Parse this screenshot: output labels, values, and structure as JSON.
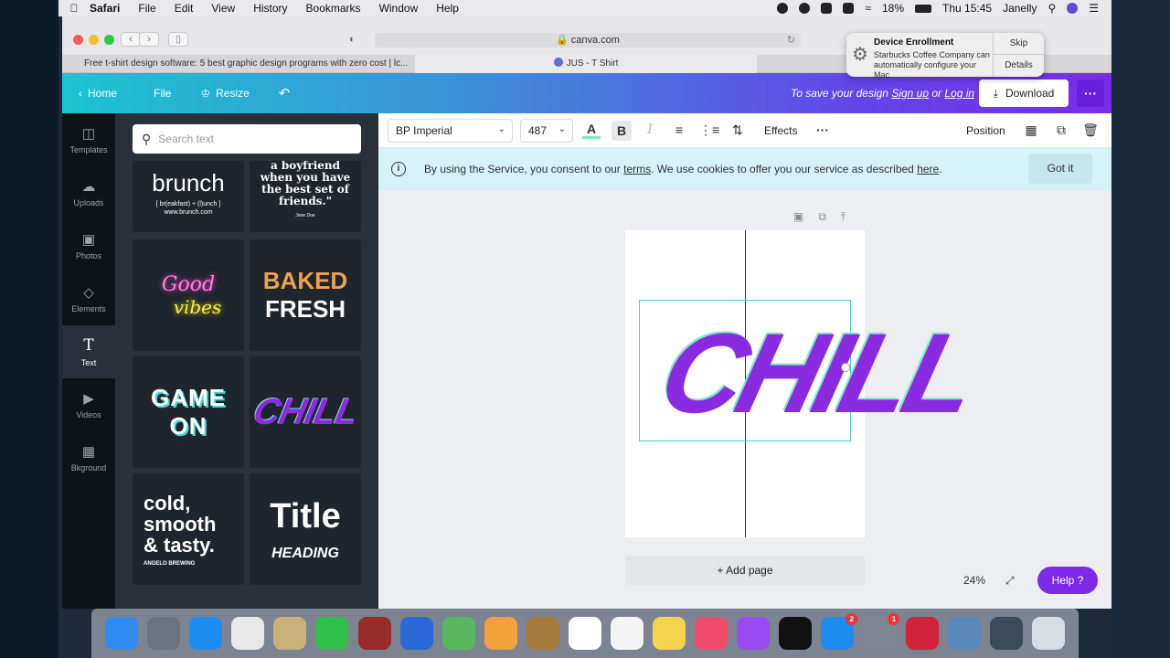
{
  "menubar": {
    "app": "Safari",
    "items": [
      "File",
      "Edit",
      "View",
      "History",
      "Bookmarks",
      "Window",
      "Help"
    ],
    "battery": "18%",
    "clock": "Thu 15:45",
    "user": "Janelly"
  },
  "browser": {
    "url": "canva.com",
    "tabs": [
      "Free t-shirt design software: 5 best graphic design programs with zero cost | lc...",
      "JUS - T Shirt"
    ]
  },
  "notification": {
    "title": "Device Enrollment",
    "body": "Starbucks Coffee Company can automatically configure your Mac.",
    "skip": "Skip",
    "details": "Details"
  },
  "header": {
    "home": "Home",
    "file": "File",
    "resize": "Resize",
    "save_prefix": "To save your design",
    "sign_up": "Sign up",
    "or": "or",
    "log_in": "Log in",
    "download": "Download"
  },
  "rail": [
    {
      "label": "Templates",
      "icon": "templates-icon"
    },
    {
      "label": "Uploads",
      "icon": "upload-icon"
    },
    {
      "label": "Photos",
      "icon": "photo-icon"
    },
    {
      "label": "Elements",
      "icon": "elements-icon"
    },
    {
      "label": "Text",
      "icon": "text-icon"
    },
    {
      "label": "Videos",
      "icon": "video-icon"
    },
    {
      "label": "Bkground",
      "icon": "background-icon"
    }
  ],
  "panel": {
    "search_placeholder": "Search text",
    "tiles": {
      "brunch": "brunch",
      "brunch_sub": "[ br(eakfast) + (l)unch ]",
      "brunch_url": "www.brunch.com",
      "quote": "a boyfriend when you have the best set of friends.\"",
      "quote_author": "Jane Doe",
      "good": "Good",
      "vibes": "vibes",
      "baked": "BAKED",
      "fresh": "FRESH",
      "game": "GAME",
      "on": "ON",
      "chill": "CHILL",
      "cold1": "cold,",
      "cold2": "smooth",
      "cold3": "& tasty.",
      "cold_brand": "ANGELO BREWING",
      "title": "Title",
      "heading": "HEADING"
    }
  },
  "editor_toolbar": {
    "font": "BP Imperial",
    "size": "487",
    "effects": "Effects",
    "position": "Position"
  },
  "cookie": {
    "prefix": "By using the Service, you consent to our",
    "terms": "terms",
    "middle": ". We use cookies to offer you our service as described",
    "here": "here",
    "suffix": ".",
    "got_it": "Got it"
  },
  "canvas": {
    "text": "CHILL",
    "add_page": "+ Add page",
    "zoom": "24%",
    "help": "Help ?"
  },
  "colors": {
    "brand_purple": "#7c2ae8",
    "chill_fill": "#8a2be2",
    "chill_outline": "#7ee8c9",
    "cookie_bg": "#d5f2f7"
  },
  "dock": [
    {
      "name": "finder-icon",
      "color": "#2f8cf0"
    },
    {
      "name": "launchpad-icon",
      "color": "#6c7480"
    },
    {
      "name": "safari-icon",
      "color": "#1e8ef2"
    },
    {
      "name": "chrome-icon",
      "color": "#e8e8e8"
    },
    {
      "name": "preview-icon",
      "color": "#c8b27a"
    },
    {
      "name": "facetime-icon",
      "color": "#2fbe4a"
    },
    {
      "name": "dictionary-icon",
      "color": "#9a2b2b"
    },
    {
      "name": "teams-icon",
      "color": "#2a6ad8"
    },
    {
      "name": "maps-icon",
      "color": "#58b85f"
    },
    {
      "name": "photos-icon",
      "color": "#f2a13c"
    },
    {
      "name": "notes-brown-icon",
      "color": "#a67a3a"
    },
    {
      "name": "calendar-icon",
      "color": "#ffffff"
    },
    {
      "name": "reminders-icon",
      "color": "#f4f4f4"
    },
    {
      "name": "notes-icon",
      "color": "#f5d34c"
    },
    {
      "name": "music-icon",
      "color": "#f24a6a"
    },
    {
      "name": "podcasts-icon",
      "color": "#9a4af2"
    },
    {
      "name": "tv-icon",
      "color": "#111111"
    },
    {
      "name": "appstore-icon",
      "color": "#1f8cf2"
    },
    {
      "name": "settings-icon",
      "color": "#808690"
    },
    {
      "name": "creative-cloud-icon",
      "color": "#d3233a"
    },
    {
      "name": "image-capture-icon",
      "color": "#5a88b8"
    },
    {
      "name": "quicktime-icon",
      "color": "#3d4a5a"
    },
    {
      "name": "trash-icon",
      "color": "#d8dde3"
    }
  ]
}
